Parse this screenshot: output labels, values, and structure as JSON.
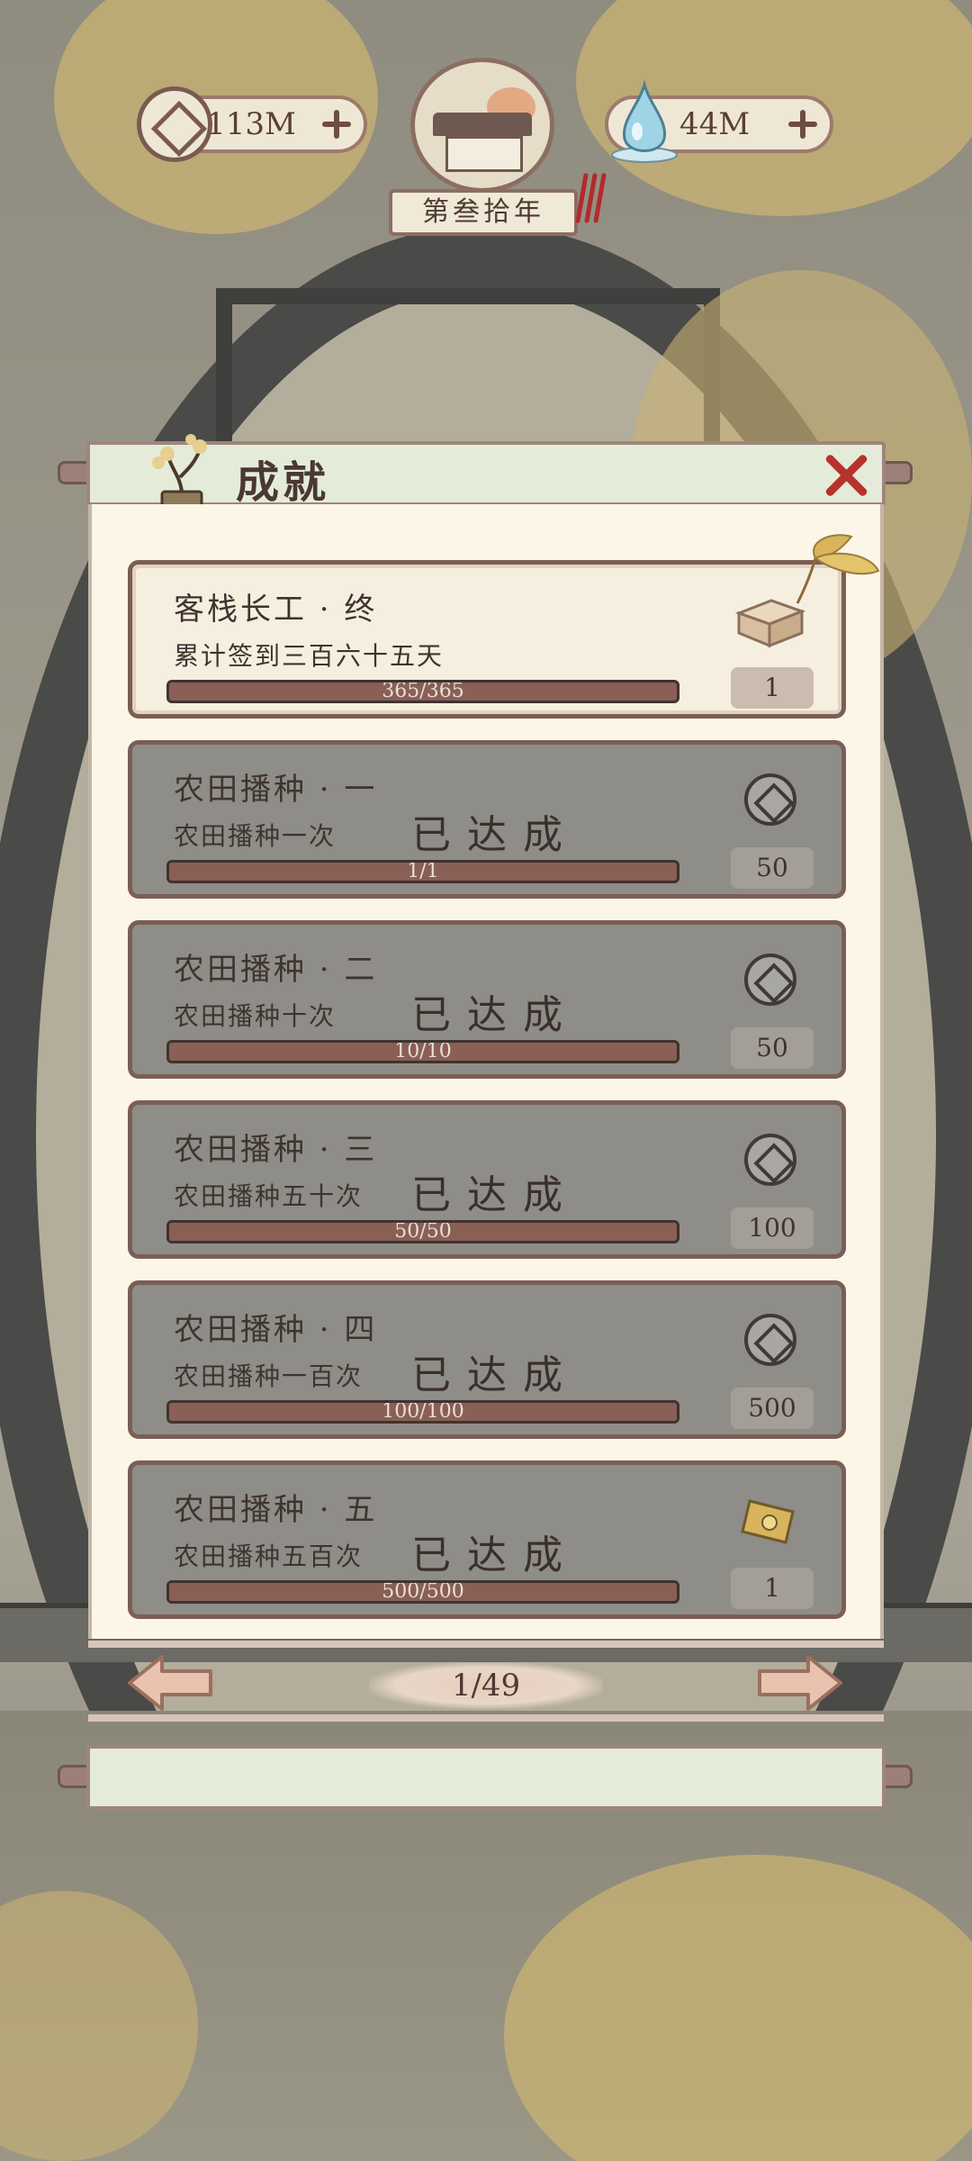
{
  "hud": {
    "coins": "113M",
    "water": "44M",
    "year": "第叁拾年"
  },
  "panel": {
    "title": "成就",
    "page": "1/49"
  },
  "achievements": [
    {
      "title": "客栈长工 · 终",
      "desc": "累计签到三百六十五天",
      "progress": "365/365",
      "fraction": 1.0,
      "reward_icon": "box-icon",
      "reward": "1",
      "done_label": "",
      "state": "active"
    },
    {
      "title": "农田播种 · 一",
      "desc": "农田播种一次",
      "progress": "1/1",
      "fraction": 1.0,
      "reward_icon": "coin-icon",
      "reward": "50",
      "done_label": "已达成",
      "state": "done"
    },
    {
      "title": "农田播种 · 二",
      "desc": "农田播种十次",
      "progress": "10/10",
      "fraction": 1.0,
      "reward_icon": "coin-icon",
      "reward": "50",
      "done_label": "已达成",
      "state": "done"
    },
    {
      "title": "农田播种 · 三",
      "desc": "农田播种五十次",
      "progress": "50/50",
      "fraction": 1.0,
      "reward_icon": "coin-icon",
      "reward": "100",
      "done_label": "已达成",
      "state": "done"
    },
    {
      "title": "农田播种 · 四",
      "desc": "农田播种一百次",
      "progress": "100/100",
      "fraction": 1.0,
      "reward_icon": "coin-icon",
      "reward": "500",
      "done_label": "已达成",
      "state": "done"
    },
    {
      "title": "农田播种 · 五",
      "desc": "农田播种五百次",
      "progress": "500/500",
      "fraction": 1.0,
      "reward_icon": "ticket-icon",
      "reward": "1",
      "done_label": "已达成",
      "state": "done"
    }
  ],
  "colors": {
    "accent": "#8a5f55",
    "close": "#b8322c",
    "panel": "#fbf6e7",
    "done_card": "#8e8d87"
  }
}
